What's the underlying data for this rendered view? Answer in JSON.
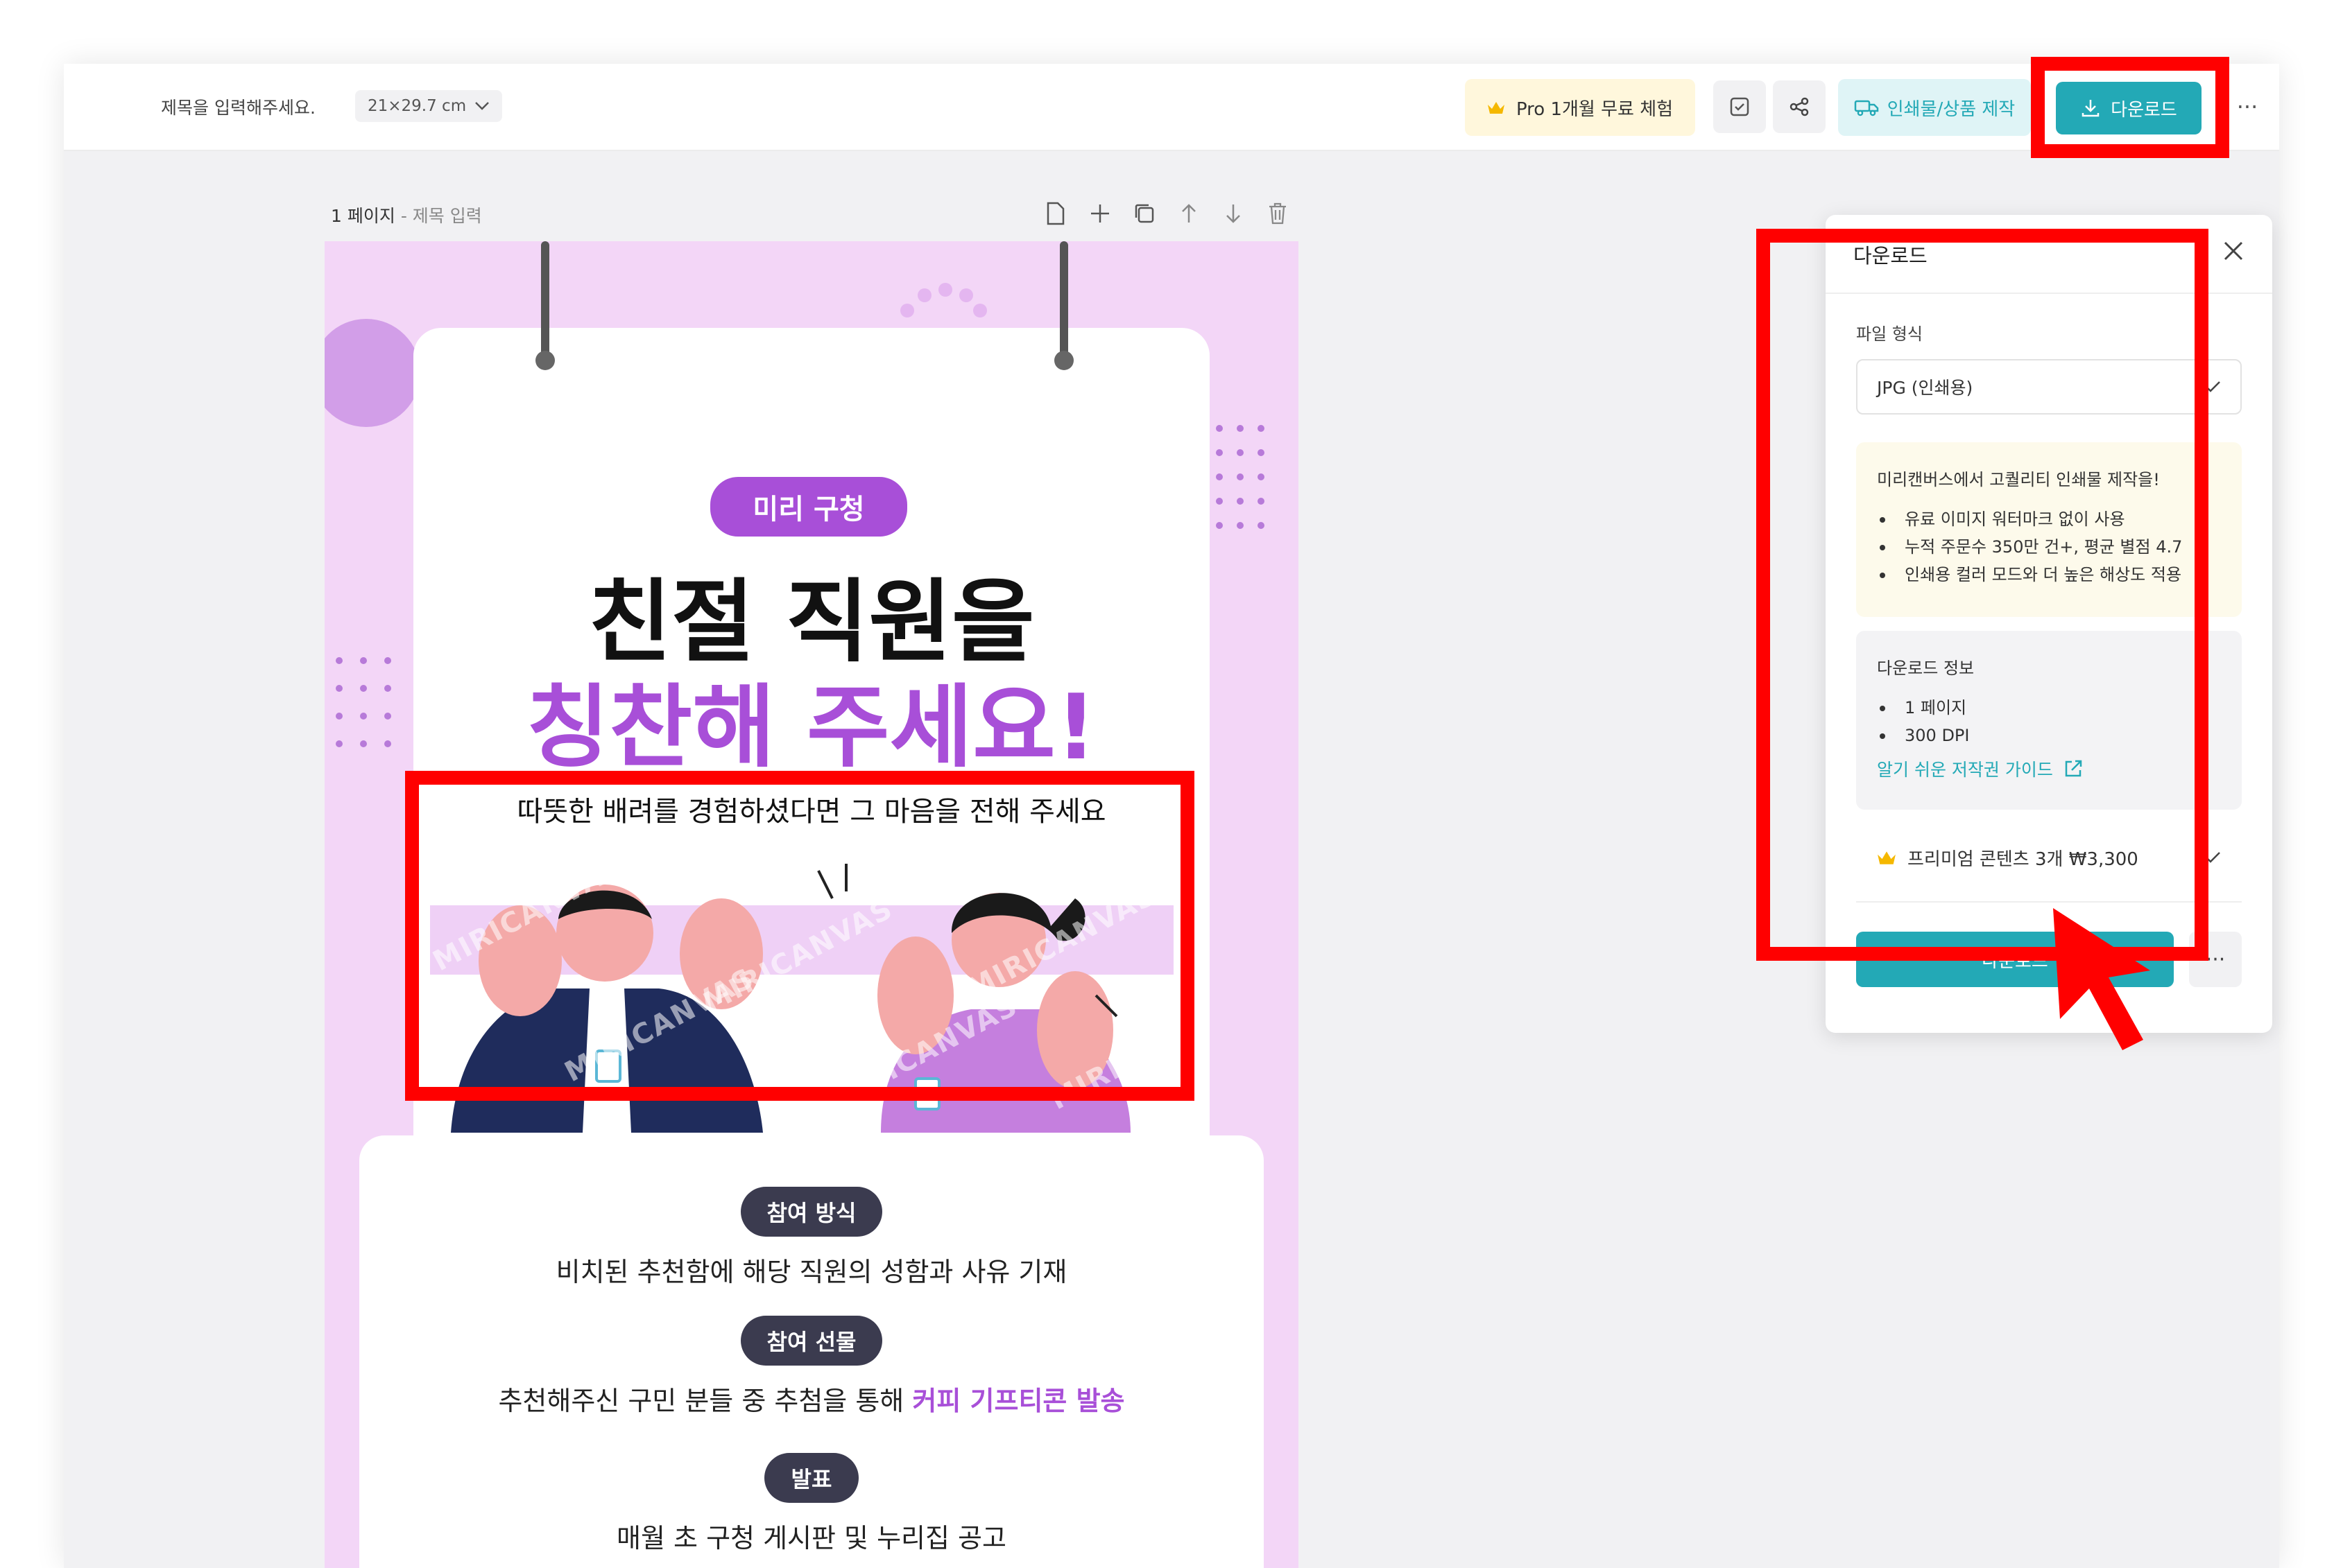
{
  "header": {
    "doc_title_placeholder": "제목을 입력해주세요.",
    "paper_size": "21×29.7 cm",
    "pro_trial_label": "Pro 1개월 무료 체험",
    "print_label": "인쇄물/상품 제작",
    "download_label": "다운로드"
  },
  "page_bar": {
    "page_number": "1 페이지",
    "title_hint": "- 제목 입력"
  },
  "poster": {
    "badge": "미리 구청",
    "headline_line1": "친절 직원을",
    "headline_line2": "칭찬해 주세요!",
    "subhead": "따뜻한 배려를 경험하셨다면 그 마음을 전해 주세요",
    "watermark": "MIRICANVAS",
    "section1_pill": "참여 방식",
    "section1_text": "비치된 추천함에 해당 직원의 성함과 사유 기재",
    "section2_pill": "참여 선물",
    "section2_text": "추천해주신 구민 분들 중 추첨을 통해",
    "section2_highlight": "커피 기프티콘 발송",
    "section3_pill": "발표",
    "section3_text": "매월 초 구청 게시판 및 누리집 공고",
    "colors": {
      "purple": "#a84fd8",
      "pink_bg": "#f3d6f7",
      "dark_pill": "#3b3b4f"
    }
  },
  "download_panel": {
    "title": "다운로드",
    "file_format_label": "파일 형식",
    "file_format_value": "JPG (인쇄용)",
    "promo_title": "미리캔버스에서 고퀄리티 인쇄물 제작을!",
    "promo_items": [
      "유료 이미지 워터마크 없이 사용",
      "누적 주문수 350만 건+, 평균 별점 4.7",
      "인쇄용 컬러 모드와 더 높은 해상도 적용"
    ],
    "info_title": "다운로드 정보",
    "info_items": [
      "1 페이지",
      "300 DPI"
    ],
    "guide_link": "알기 쉬운 저작권 가이드",
    "premium_text": "프리미엄 콘텐츠 3개 ₩3,300",
    "download_button": "다운로드",
    "more_button": "···"
  },
  "accent_color": "#23a9b6",
  "annotation_color": "#ff0000"
}
